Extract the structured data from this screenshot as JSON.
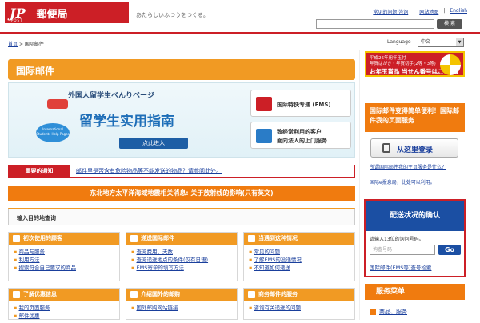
{
  "header": {
    "logo_brand": "JP",
    "logo_post": "POST",
    "logo_name": "郵便局",
    "slogan": "あたらしいふつうをつくる。",
    "top_links": [
      "常见的问题·咨询",
      "网站地图",
      "English"
    ],
    "search_placeholder": "",
    "search_button": "検 索"
  },
  "breadcrumb": {
    "home": "首页",
    "separator": ">",
    "current": "国际邮件"
  },
  "language": {
    "label": "Language",
    "selected": "中文"
  },
  "main": {
    "title": "国际邮件",
    "banner": {
      "jp_title": "外国人留学生べんりページ",
      "title": "留学生实用指南",
      "button": "点此进入",
      "badge": "International Students Help Pages",
      "box1": "国际特快专递 (EMS)",
      "box2_line1": "致经常利用的客户",
      "box2_line2": "面向法人的上门服务"
    },
    "notice": {
      "label": "重要的通知",
      "text": "邮件里是否含有危险物品等不能发送的物品？请参阅此外。"
    },
    "quake_notice": "东北地方太平洋海域地震相关消息: 关于放射线的影响(只有英文)",
    "destination_title": "输入目的地查询",
    "cards": [
      {
        "title": "初次使用的顾客",
        "items": [
          "商品与服务",
          "利用方法",
          "搜索符合自己要求的商品"
        ]
      },
      {
        "title": "递送国际邮件",
        "items": [
          "查阅费用、天数",
          "查阅递送地点的条件(仅有日语)",
          "EMS寄单的填写方法"
        ]
      },
      {
        "title": "当遇到这种情况",
        "items": [
          "常见的问题",
          "了解EMS的投递情况",
          "不知道如何递送"
        ]
      },
      {
        "title": "了解优惠信息",
        "items": [
          "我的页面服务",
          "邮件优惠"
        ]
      },
      {
        "title": "介绍国外的邮购",
        "items": [
          "国外邮购网站链接"
        ]
      },
      {
        "title": "商务邮件的服务",
        "items": [
          "咨询有关递送的问题"
        ]
      }
    ]
  },
  "sidebar": {
    "promo_line1": "平成26年用年玉付",
    "promo_line2": "年賀はがき・年賀切手(2等・3等)",
    "promo_line3": "お年玉賞品 当せん番号はこちら!",
    "easy_title": "国际邮件变得简单便利！国际邮件我的页面服务",
    "login_button": "从这里登录",
    "text1": "所谓国际邮件我的主页服务是什么？",
    "text2": "国际e报息局，此处可以利用。",
    "tracking": {
      "title": "配送状况的确认",
      "hint": "请输入13位的询问号码。",
      "placeholder": "询查号码",
      "button": "Go",
      "link": "国际邮件(EMS等)查号检索"
    },
    "service_menu": "服务菜单",
    "service_item": "商品、服务"
  },
  "colors": {
    "brand_red": "#cc1f26",
    "orange": "#f19a23",
    "blue": "#1b4fa3"
  }
}
